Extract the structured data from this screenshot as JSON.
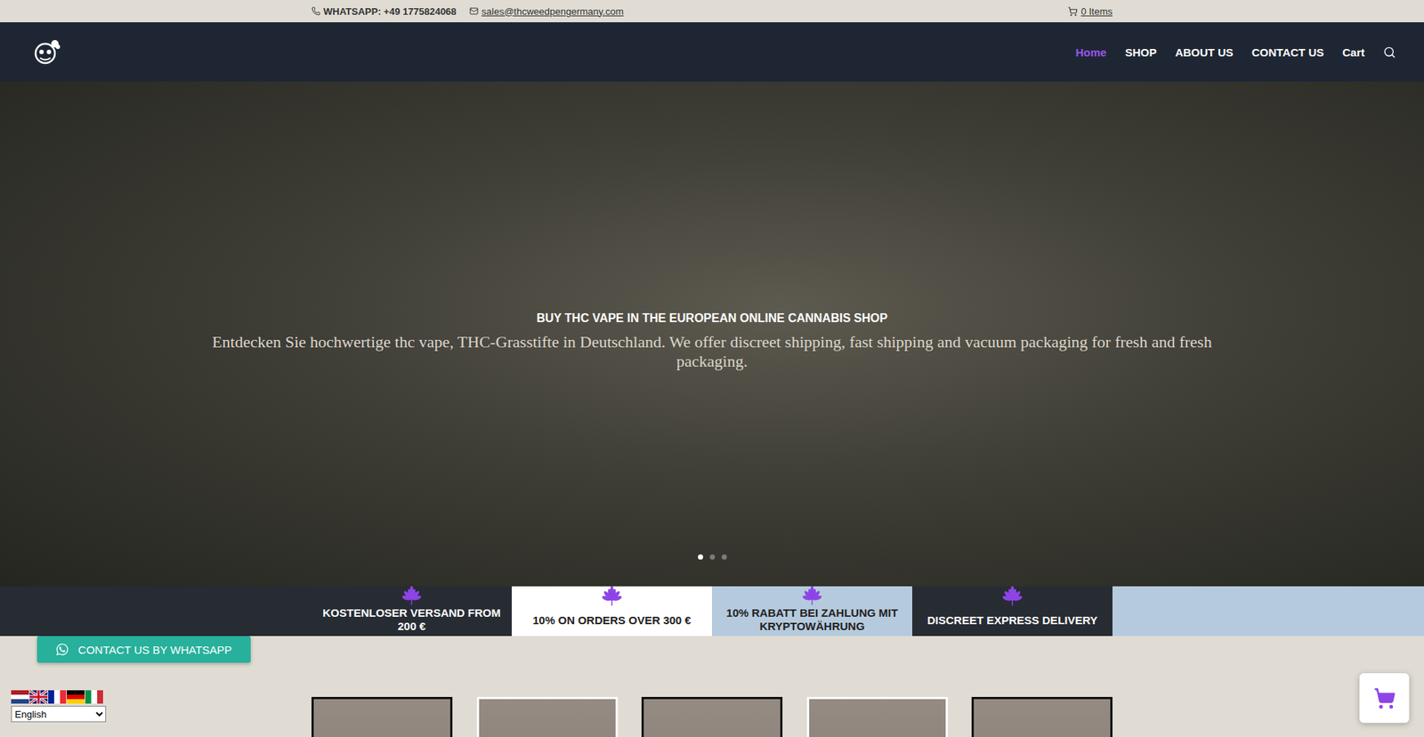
{
  "topbar": {
    "phone": "WHATSAPP: +49 1775824068",
    "email": "sales@thcweedpengermany.com",
    "cart": "0 Items"
  },
  "nav": {
    "items": [
      {
        "label": "Home",
        "selected": true
      },
      {
        "label": "SHOP",
        "selected": false
      },
      {
        "label": "ABOUT US",
        "selected": false
      },
      {
        "label": "CONTACT US",
        "selected": false
      },
      {
        "label": "Cart",
        "selected": false
      }
    ]
  },
  "hero": {
    "title": "BUY THC VAPE IN THE EUROPEAN ONLINE CANNABIS SHOP",
    "subtitle": "Entdecken Sie hochwertige thc vape, THC-Grasstifte in Deutschland. We offer discreet shipping, fast shipping and vacuum packaging for fresh and fresh packaging.",
    "slides": [
      {
        "selected": true
      },
      {
        "selected": false
      },
      {
        "selected": false
      }
    ]
  },
  "features": [
    {
      "label": "KOSTENLOSER VERSAND FROM 200 €",
      "color": "#272c33"
    },
    {
      "label": "10% ON ORDERS OVER 300 €",
      "color": "#ffffff"
    },
    {
      "label": "10% RABATT BEI ZAHLUNG MIT KRYPTOWÄHRUNG",
      "color": "#b5cadd"
    },
    {
      "label": "DISCREET EXPRESS DELIVERY",
      "color": "#272c33"
    }
  ],
  "whatsapp_button": "CONTACT US BY WHATSAPP",
  "language": {
    "selected": "English"
  },
  "products": [
    {
      "color": "#111111"
    },
    {
      "color": "#ffffff"
    },
    {
      "color": "#111111"
    },
    {
      "color": "#ffffff"
    },
    {
      "color": "#111111"
    }
  ]
}
